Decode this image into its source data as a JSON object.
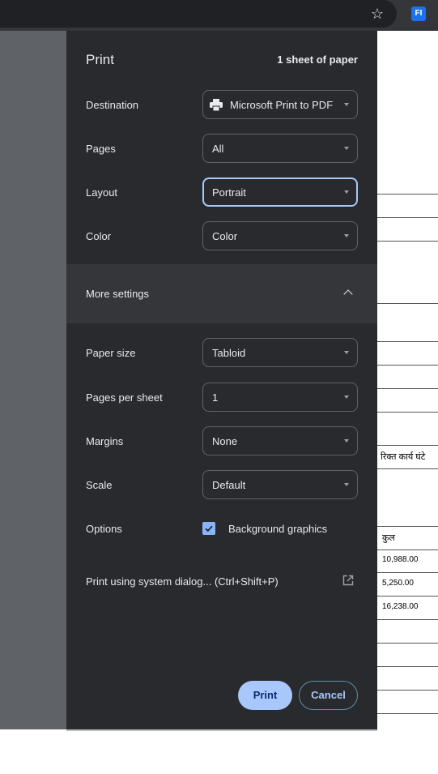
{
  "toolbar": {
    "bookmark_icon": "star-icon",
    "extension_label": "FI"
  },
  "document": {
    "header_text": "रिक्त कार्य घंटे",
    "total_label": "कुल",
    "values": [
      "10,988.00",
      "5,250.00",
      "16,238.00"
    ]
  },
  "dialog": {
    "title": "Print",
    "sheets": "1 sheet of paper",
    "destination": {
      "label": "Destination",
      "value": "Microsoft Print to PDF",
      "icon": "printer-icon"
    },
    "pages": {
      "label": "Pages",
      "value": "All"
    },
    "layout": {
      "label": "Layout",
      "value": "Portrait"
    },
    "color": {
      "label": "Color",
      "value": "Color"
    },
    "more_settings": {
      "label": "More settings",
      "icon": "chevron-up-icon"
    },
    "paper_size": {
      "label": "Paper size",
      "value": "Tabloid"
    },
    "pages_per_sheet": {
      "label": "Pages per sheet",
      "value": "1"
    },
    "margins": {
      "label": "Margins",
      "value": "None"
    },
    "scale": {
      "label": "Scale",
      "value": "Default"
    },
    "options": {
      "label": "Options",
      "background_graphics": "Background graphics",
      "checked": true
    },
    "system_dialog": {
      "label": "Print using system dialog... (Ctrl+Shift+P)",
      "icon": "open-in-new-icon"
    },
    "print_button": "Print",
    "cancel_button": "Cancel"
  },
  "colors": {
    "panel_bg": "#292a2d",
    "accent": "#a8c7fa",
    "text": "#e8eaed"
  }
}
